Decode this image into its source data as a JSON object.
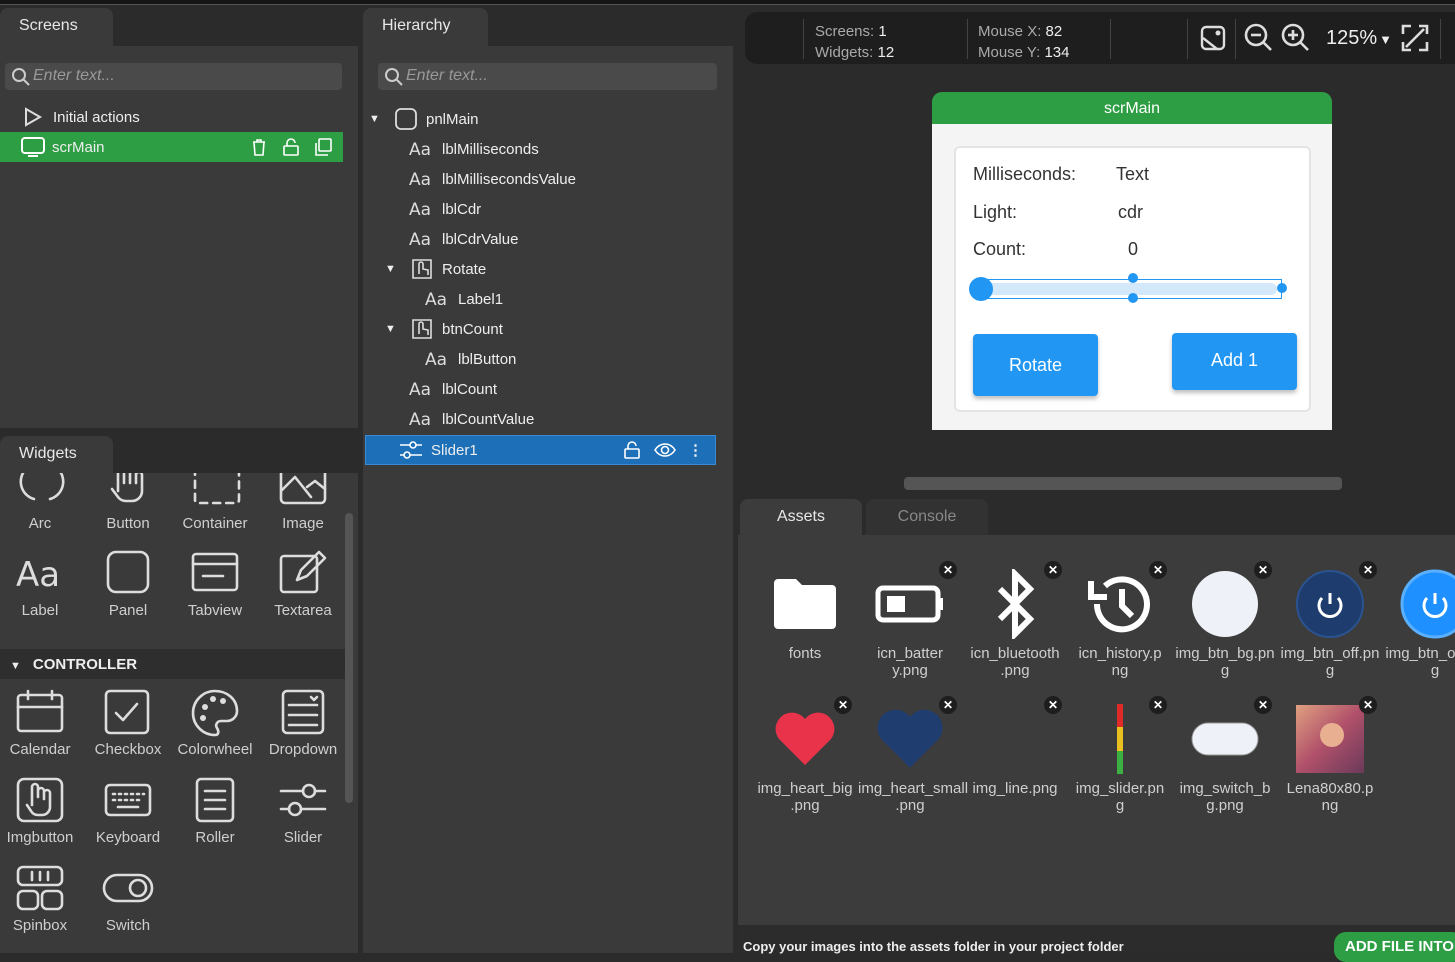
{
  "screens": {
    "tab": "Screens",
    "search_placeholder": "Enter text...",
    "items": [
      {
        "label": "Initial actions"
      },
      {
        "label": "scrMain"
      }
    ]
  },
  "widgets": {
    "tab": "Widgets",
    "section": "CONTROLLER",
    "basic": [
      {
        "label": "Arc",
        "icon": "arc-icon"
      },
      {
        "label": "Button",
        "icon": "button-icon"
      },
      {
        "label": "Container",
        "icon": "container-icon"
      },
      {
        "label": "Image",
        "icon": "image-icon"
      },
      {
        "label": "Label",
        "icon": "label-icon"
      },
      {
        "label": "Panel",
        "icon": "panel-icon"
      },
      {
        "label": "Tabview",
        "icon": "tabview-icon"
      },
      {
        "label": "Textarea",
        "icon": "textarea-icon"
      }
    ],
    "controller": [
      {
        "label": "Calendar",
        "icon": "calendar-icon"
      },
      {
        "label": "Checkbox",
        "icon": "checkbox-icon"
      },
      {
        "label": "Colorwheel",
        "icon": "colorwheel-icon"
      },
      {
        "label": "Dropdown",
        "icon": "dropdown-icon"
      },
      {
        "label": "Imgbutton",
        "icon": "imgbutton-icon"
      },
      {
        "label": "Keyboard",
        "icon": "keyboard-icon"
      },
      {
        "label": "Roller",
        "icon": "roller-icon"
      },
      {
        "label": "Slider",
        "icon": "slider-icon"
      },
      {
        "label": "Spinbox",
        "icon": "spinbox-icon"
      },
      {
        "label": "Switch",
        "icon": "switch-icon"
      }
    ]
  },
  "hierarchy": {
    "tab": "Hierarchy",
    "search_placeholder": "Enter text...",
    "items": [
      {
        "label": "pnlMain",
        "type": "panel",
        "depth": 0,
        "expanded": true
      },
      {
        "label": "lblMilliseconds",
        "type": "label",
        "depth": 1
      },
      {
        "label": "lblMillisecondsValue",
        "type": "label",
        "depth": 1
      },
      {
        "label": "lblCdr",
        "type": "label",
        "depth": 1
      },
      {
        "label": "lblCdrValue",
        "type": "label",
        "depth": 1
      },
      {
        "label": "Rotate",
        "type": "button",
        "depth": 1,
        "expanded": true
      },
      {
        "label": "Label1",
        "type": "label",
        "depth": 2
      },
      {
        "label": "btnCount",
        "type": "button",
        "depth": 1,
        "expanded": true
      },
      {
        "label": "lblButton",
        "type": "label",
        "depth": 2
      },
      {
        "label": "lblCount",
        "type": "label",
        "depth": 1
      },
      {
        "label": "lblCountValue",
        "type": "label",
        "depth": 1
      },
      {
        "label": "Slider1",
        "type": "slider",
        "depth": 1,
        "selected": true
      }
    ]
  },
  "toolbar": {
    "screens_label": "Screens:",
    "screens": "1",
    "widgets_label": "Widgets:",
    "widgets": "12",
    "mouse_x_label": "Mouse X:",
    "mouse_x": "82",
    "mouse_y_label": "Mouse Y:",
    "mouse_y": "134",
    "zoom": "125%"
  },
  "preview": {
    "screen_title": "scrMain",
    "ms_label": "Milliseconds:",
    "ms_value": "Text",
    "light_label": "Light:",
    "light_value": "cdr",
    "count_label": "Count:",
    "count_value": "0",
    "slider_value": 0,
    "rotate_btn": "Rotate",
    "add_btn": "Add 1"
  },
  "assets": {
    "tabs": [
      "Assets",
      "Console"
    ],
    "items": [
      {
        "name": "fonts",
        "kind": "folder"
      },
      {
        "name": "icn_battery.png"
      },
      {
        "name": "icn_bluetooth.png"
      },
      {
        "name": "icn_history.png"
      },
      {
        "name": "img_btn_bg.png"
      },
      {
        "name": "img_btn_off.png"
      },
      {
        "name": "img_btn_on.png"
      },
      {
        "name": "img_heart_big.png"
      },
      {
        "name": "img_heart_small.png"
      },
      {
        "name": "img_line.png"
      },
      {
        "name": "img_slider.png"
      },
      {
        "name": "img_switch_bg.png"
      },
      {
        "name": "Lena80x80.png"
      }
    ],
    "footer": "Copy your images into the assets folder in your project folder",
    "add_button": "ADD FILE INTO"
  },
  "colors": {
    "accent_green": "#2e9e44",
    "selection_blue": "#1d6fb8",
    "lvgl_blue": "#2196f3"
  }
}
